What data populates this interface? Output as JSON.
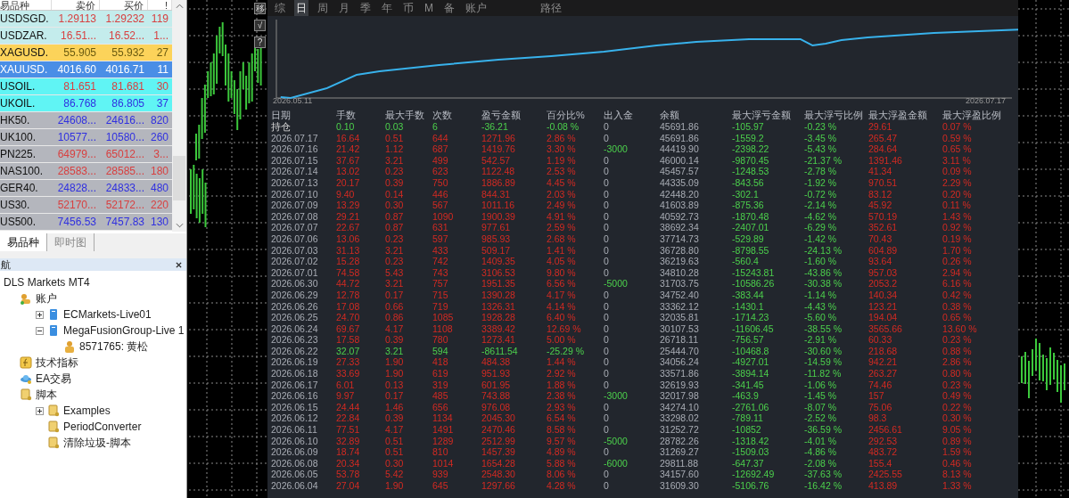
{
  "market_watch": {
    "columns": [
      "易品种",
      "卖价",
      "买价",
      "!"
    ],
    "rows": [
      {
        "symbol": "USDSGD.",
        "bid": "1.29113",
        "ask": "1.29232",
        "spread": "119",
        "color": "#c4ecec",
        "kind": "plain",
        "rising": false
      },
      {
        "symbol": "USDZAR.",
        "bid": "16.51...",
        "ask": "16.52...",
        "spread": "1...",
        "color": "#c4ecec",
        "kind": "plain",
        "rising": false
      },
      {
        "symbol": "XAGUSD.",
        "bid": "55.905",
        "ask": "55.932",
        "spread": "27",
        "color": "#fcd35a",
        "kind": "gold"
      },
      {
        "symbol": "XAUUSD.",
        "bid": "4016.60",
        "ask": "4016.71",
        "spread": "11",
        "color": "#4a8ee6",
        "kind": "selected"
      },
      {
        "symbol": "USOIL.",
        "bid": "81.651",
        "ask": "81.681",
        "spread": "30",
        "color": "#60f4f4",
        "kind": "plain",
        "rising": false
      },
      {
        "symbol": "UKOIL.",
        "bid": "86.768",
        "ask": "86.805",
        "spread": "37",
        "color": "#60f4f4",
        "kind": "plain",
        "rising": true
      },
      {
        "symbol": "HK50.",
        "bid": "24608...",
        "ask": "24616...",
        "spread": "820",
        "color": "#b4b6bd",
        "kind": "plain",
        "rising": true
      },
      {
        "symbol": "UK100.",
        "bid": "10577...",
        "ask": "10580...",
        "spread": "260",
        "color": "#b4b6bd",
        "kind": "plain",
        "rising": true
      },
      {
        "symbol": "PN225.",
        "bid": "64979...",
        "ask": "65012...",
        "spread": "3...",
        "color": "#b4b6bd",
        "kind": "plain",
        "rising": false
      },
      {
        "symbol": "NAS100.",
        "bid": "28583...",
        "ask": "28585...",
        "spread": "180",
        "color": "#b4b6bd",
        "kind": "plain",
        "rising": false
      },
      {
        "symbol": "GER40.",
        "bid": "24828...",
        "ask": "24833...",
        "spread": "480",
        "color": "#b4b6bd",
        "kind": "plain",
        "rising": true
      },
      {
        "symbol": "US30.",
        "bid": "52170...",
        "ask": "52172...",
        "spread": "220",
        "color": "#b4b6bd",
        "kind": "plain",
        "rising": false
      },
      {
        "symbol": "US500.",
        "bid": "7456.53",
        "ask": "7457.83",
        "spread": "130",
        "color": "#b4b6bd",
        "kind": "plain",
        "rising": true
      }
    ],
    "tabs": [
      {
        "label": "易品种",
        "selected": true
      },
      {
        "label": "即时图",
        "selected": false
      }
    ]
  },
  "navigator": {
    "title": "航",
    "tree": [
      {
        "label": "DLS Markets MT4",
        "children": [
          {
            "label": "账户",
            "kind": "accounts",
            "children": [
              {
                "label": "ECMarkets-Live01",
                "kind": "server",
                "expanded": false
              },
              {
                "label": "MegaFusionGroup-Live 1",
                "kind": "server",
                "expanded": true,
                "children": [
                  {
                    "label": "8571765: 黄松",
                    "kind": "user"
                  }
                ]
              }
            ]
          },
          {
            "label": "技术指标",
            "kind": "indicator"
          },
          {
            "label": "EA交易",
            "kind": "expert"
          },
          {
            "label": "脚本",
            "kind": "script",
            "children": [
              {
                "label": "Examples",
                "kind": "script",
                "expanded": false
              },
              {
                "label": "PeriodConverter",
                "kind": "script"
              },
              {
                "label": "清除垃圾-脚本",
                "kind": "script"
              }
            ]
          }
        ]
      }
    ]
  },
  "chart_toolbar": [
    "移",
    "√",
    "?"
  ],
  "report": {
    "tabs": [
      {
        "label": "综",
        "selected": false
      },
      {
        "label": "日",
        "selected": true
      },
      {
        "label": "周",
        "selected": false
      },
      {
        "label": "月",
        "selected": false
      },
      {
        "label": "季",
        "selected": false
      },
      {
        "label": "年",
        "selected": false
      },
      {
        "label": "币",
        "selected": false
      },
      {
        "label": "M",
        "selected": false
      },
      {
        "label": "备",
        "selected": false
      },
      {
        "label": "账户",
        "selected": false
      },
      {
        "label": "路径",
        "selected": false
      }
    ],
    "equity_chart": {
      "start_label": "2026.05.11",
      "end_label": "2026.07.17"
    },
    "columns": [
      "日期",
      "手数",
      "最大手数",
      "次数",
      "盈亏金额",
      "百分比%",
      "出入金",
      "余额",
      "最大浮亏金额",
      "最大浮亏比例",
      "最大浮盈金额",
      "最大浮盈比例"
    ],
    "rows": [
      {
        "cells": [
          "持仓",
          "0.10",
          "0.03",
          "6",
          "-36.21",
          "-0.08 %",
          "0",
          "45691.86",
          "-105.97",
          "-0.23 %",
          "29.61",
          "0.07 %"
        ],
        "loss": true,
        "withdrawal": false
      },
      {
        "cells": [
          "2026.07.17",
          "16.64",
          "0.51",
          "644",
          "1271.96",
          "2.86 %",
          "0",
          "45691.86",
          "-1559.2",
          "-3.45 %",
          "265.47",
          "0.59 %"
        ],
        "loss": false,
        "withdrawal": false
      },
      {
        "cells": [
          "2026.07.16",
          "21.42",
          "1.12",
          "687",
          "1419.76",
          "3.30 %",
          "-3000",
          "44419.90",
          "-2398.22",
          "-5.43 %",
          "284.64",
          "0.65 %"
        ],
        "loss": false,
        "withdrawal": true
      },
      {
        "cells": [
          "2026.07.15",
          "37.67",
          "3.21",
          "499",
          "542.57",
          "1.19 %",
          "0",
          "46000.14",
          "-9870.45",
          "-21.37 %",
          "1391.46",
          "3.11 %"
        ],
        "loss": false,
        "withdrawal": false
      },
      {
        "cells": [
          "2026.07.14",
          "13.02",
          "0.23",
          "623",
          "1122.48",
          "2.53 %",
          "0",
          "45457.57",
          "-1248.53",
          "-2.78 %",
          "41.34",
          "0.09 %"
        ],
        "loss": false,
        "withdrawal": false
      },
      {
        "cells": [
          "2026.07.13",
          "20.17",
          "0.39",
          "750",
          "1886.89",
          "4.45 %",
          "0",
          "44335.09",
          "-843.56",
          "-1.92 %",
          "970.51",
          "2.29 %"
        ],
        "loss": false,
        "withdrawal": false
      },
      {
        "cells": [
          "2026.07.10",
          "9.40",
          "0.14",
          "446",
          "844.31",
          "2.03 %",
          "0",
          "42448.20",
          "-302.1",
          "-0.72 %",
          "83.12",
          "0.20 %"
        ],
        "loss": false,
        "withdrawal": false
      },
      {
        "cells": [
          "2026.07.09",
          "13.29",
          "0.30",
          "567",
          "1011.16",
          "2.49 %",
          "0",
          "41603.89",
          "-875.36",
          "-2.14 %",
          "45.92",
          "0.11 %"
        ],
        "loss": false,
        "withdrawal": false
      },
      {
        "cells": [
          "2026.07.08",
          "29.21",
          "0.87",
          "1090",
          "1900.39",
          "4.91 %",
          "0",
          "40592.73",
          "-1870.48",
          "-4.62 %",
          "570.19",
          "1.43 %"
        ],
        "loss": false,
        "withdrawal": false
      },
      {
        "cells": [
          "2026.07.07",
          "22.67",
          "0.87",
          "631",
          "977.61",
          "2.59 %",
          "0",
          "38692.34",
          "-2407.01",
          "-6.29 %",
          "352.61",
          "0.92 %"
        ],
        "loss": false,
        "withdrawal": false
      },
      {
        "cells": [
          "2026.07.06",
          "13.06",
          "0.23",
          "597",
          "985.93",
          "2.68 %",
          "0",
          "37714.73",
          "-529.89",
          "-1.42 %",
          "70.43",
          "0.19 %"
        ],
        "loss": false,
        "withdrawal": false
      },
      {
        "cells": [
          "2026.07.03",
          "31.13",
          "3.21",
          "433",
          "509.17",
          "1.41 %",
          "0",
          "36728.80",
          "-8798.55",
          "-24.13 %",
          "604.89",
          "1.70 %"
        ],
        "loss": false,
        "withdrawal": false
      },
      {
        "cells": [
          "2026.07.02",
          "15.28",
          "0.23",
          "742",
          "1409.35",
          "4.05 %",
          "0",
          "36219.63",
          "-560.4",
          "-1.60 %",
          "93.64",
          "0.26 %"
        ],
        "loss": false,
        "withdrawal": false
      },
      {
        "cells": [
          "2026.07.01",
          "74.58",
          "5.43",
          "743",
          "3106.53",
          "9.80 %",
          "0",
          "34810.28",
          "-15243.81",
          "-43.86 %",
          "957.03",
          "2.94 %"
        ],
        "loss": false,
        "withdrawal": false
      },
      {
        "cells": [
          "2026.06.30",
          "44.72",
          "3.21",
          "757",
          "1951.35",
          "6.56 %",
          "-5000",
          "31703.75",
          "-10586.26",
          "-30.38 %",
          "2053.2",
          "6.16 %"
        ],
        "loss": false,
        "withdrawal": true
      },
      {
        "cells": [
          "2026.06.29",
          "12.78",
          "0.17",
          "715",
          "1390.28",
          "4.17 %",
          "0",
          "34752.40",
          "-383.44",
          "-1.14 %",
          "140.34",
          "0.42 %"
        ],
        "loss": false,
        "withdrawal": false
      },
      {
        "cells": [
          "2026.06.26",
          "17.08",
          "0.66",
          "719",
          "1326.31",
          "4.14 %",
          "0",
          "33362.12",
          "-1430.1",
          "-4.43 %",
          "123.21",
          "0.38 %"
        ],
        "loss": false,
        "withdrawal": false
      },
      {
        "cells": [
          "2026.06.25",
          "24.70",
          "0.86",
          "1085",
          "1928.28",
          "6.40 %",
          "0",
          "32035.81",
          "-1714.23",
          "-5.60 %",
          "194.04",
          "0.65 %"
        ],
        "loss": false,
        "withdrawal": false
      },
      {
        "cells": [
          "2026.06.24",
          "69.67",
          "4.17",
          "1108",
          "3389.42",
          "12.69 %",
          "0",
          "30107.53",
          "-11606.45",
          "-38.55 %",
          "3565.66",
          "13.60 %"
        ],
        "loss": false,
        "withdrawal": false
      },
      {
        "cells": [
          "2026.06.23",
          "17.58",
          "0.39",
          "780",
          "1273.41",
          "5.00 %",
          "0",
          "26718.11",
          "-756.57",
          "-2.91 %",
          "60.33",
          "0.23 %"
        ],
        "loss": false,
        "withdrawal": false
      },
      {
        "cells": [
          "2026.06.22",
          "32.07",
          "3.21",
          "594",
          "-8611.54",
          "-25.29 %",
          "0",
          "25444.70",
          "-10468.8",
          "-30.60 %",
          "218.68",
          "0.88 %"
        ],
        "loss": true,
        "withdrawal": false
      },
      {
        "cells": [
          "2026.06.19",
          "27.33",
          "1.90",
          "418",
          "484.38",
          "1.44 %",
          "0",
          "34056.24",
          "-4927.01",
          "-14.59 %",
          "942.21",
          "2.86 %"
        ],
        "loss": false,
        "withdrawal": false
      },
      {
        "cells": [
          "2026.06.18",
          "33.69",
          "1.90",
          "619",
          "951.93",
          "2.92 %",
          "0",
          "33571.86",
          "-3894.14",
          "-11.82 %",
          "263.27",
          "0.80 %"
        ],
        "loss": false,
        "withdrawal": false
      },
      {
        "cells": [
          "2026.06.17",
          "6.01",
          "0.13",
          "319",
          "601.95",
          "1.88 %",
          "0",
          "32619.93",
          "-341.45",
          "-1.06 %",
          "74.46",
          "0.23 %"
        ],
        "loss": false,
        "withdrawal": false
      },
      {
        "cells": [
          "2026.06.16",
          "9.97",
          "0.17",
          "485",
          "743.88",
          "2.38 %",
          "-3000",
          "32017.98",
          "-463.9",
          "-1.45 %",
          "157",
          "0.49 %"
        ],
        "loss": false,
        "withdrawal": true
      },
      {
        "cells": [
          "2026.06.15",
          "24.44",
          "1.46",
          "656",
          "976.08",
          "2.93 %",
          "0",
          "34274.10",
          "-2761.06",
          "-8.07 %",
          "75.06",
          "0.22 %"
        ],
        "loss": false,
        "withdrawal": false
      },
      {
        "cells": [
          "2026.06.12",
          "22.84",
          "0.39",
          "1134",
          "2045.30",
          "6.54 %",
          "0",
          "33298.02",
          "-789.11",
          "-2.52 %",
          "98.3",
          "0.30 %"
        ],
        "loss": false,
        "withdrawal": false
      },
      {
        "cells": [
          "2026.06.11",
          "77.51",
          "4.17",
          "1491",
          "2470.46",
          "8.58 %",
          "0",
          "31252.72",
          "-10852",
          "-36.59 %",
          "2456.61",
          "9.05 %"
        ],
        "loss": false,
        "withdrawal": false
      },
      {
        "cells": [
          "2026.06.10",
          "32.89",
          "0.51",
          "1289",
          "2512.99",
          "9.57 %",
          "-5000",
          "28782.26",
          "-1318.42",
          "-4.01 %",
          "292.53",
          "0.89 %"
        ],
        "loss": false,
        "withdrawal": true
      },
      {
        "cells": [
          "2026.06.09",
          "18.74",
          "0.51",
          "810",
          "1457.39",
          "4.89 %",
          "0",
          "31269.27",
          "-1509.03",
          "-4.86 %",
          "483.72",
          "1.59 %"
        ],
        "loss": false,
        "withdrawal": false
      },
      {
        "cells": [
          "2026.06.08",
          "20.34",
          "0.30",
          "1014",
          "1654.28",
          "5.88 %",
          "-6000",
          "29811.88",
          "-647.37",
          "-2.08 %",
          "155.4",
          "0.46 %"
        ],
        "loss": false,
        "withdrawal": true
      },
      {
        "cells": [
          "2026.06.05",
          "53.78",
          "5.42",
          "939",
          "2548.30",
          "8.06 %",
          "0",
          "34157.60",
          "-12692.49",
          "-37.63 %",
          "2425.55",
          "8.13 %"
        ],
        "loss": false,
        "withdrawal": false
      },
      {
        "cells": [
          "2026.06.04",
          "27.04",
          "1.90",
          "645",
          "1297.66",
          "4.28 %",
          "0",
          "31609.30",
          "-5106.76",
          "-16.42 %",
          "413.89",
          "1.33 %"
        ],
        "loss": false,
        "withdrawal": false
      }
    ]
  }
}
